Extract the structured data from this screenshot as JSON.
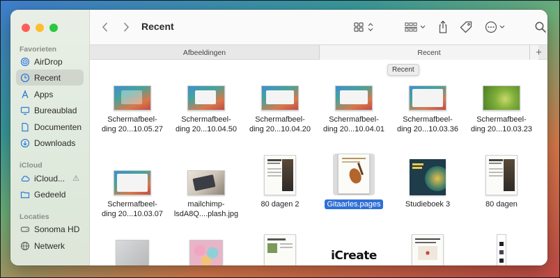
{
  "window": {
    "title": "Recent"
  },
  "sidebar": {
    "sections": [
      {
        "label": "Favorieten"
      },
      {
        "label": "iCloud"
      },
      {
        "label": "Locaties"
      }
    ],
    "items": [
      {
        "label": "AirDrop",
        "icon": "airdrop-icon"
      },
      {
        "label": "Recent",
        "icon": "clock-icon",
        "active": true
      },
      {
        "label": "Apps",
        "icon": "apps-icon"
      },
      {
        "label": "Bureaublad",
        "icon": "desktop-icon"
      },
      {
        "label": "Documenten",
        "icon": "document-icon"
      },
      {
        "label": "Downloads",
        "icon": "download-icon"
      },
      {
        "label": "iCloud...",
        "icon": "cloud-icon"
      },
      {
        "label": "Gedeeld",
        "icon": "shared-folder-icon"
      },
      {
        "label": "Sonoma HD",
        "icon": "disk-icon"
      },
      {
        "label": "Netwerk",
        "icon": "network-icon"
      }
    ]
  },
  "tabs": [
    {
      "label": "Afbeeldingen"
    },
    {
      "label": "Recent"
    }
  ],
  "tooltip": "Recent",
  "files": [
    {
      "line1": "Schermafbeel-",
      "line2": "ding 20...10.05.27",
      "kind": "screenshot"
    },
    {
      "line1": "Schermafbeel-",
      "line2": "ding 20...10.04.50",
      "kind": "screenshot"
    },
    {
      "line1": "Schermafbeel-",
      "line2": "ding 20...10.04.20",
      "kind": "screenshot"
    },
    {
      "line1": "Schermafbeel-",
      "line2": "ding 20...10.04.01",
      "kind": "screenshot"
    },
    {
      "line1": "Schermafbeel-",
      "line2": "ding 20...10.03.36",
      "kind": "screenshot"
    },
    {
      "line1": "Schermafbeel-",
      "line2": "ding 20...10.03.23",
      "kind": "screenshot-green"
    },
    {
      "line1": "Schermafbeel-",
      "line2": "ding 20...10.03.07",
      "kind": "screenshot"
    },
    {
      "line1": "mailchimp-",
      "line2": "lsdA8Q....plash.jpg",
      "kind": "photo"
    },
    {
      "line1": "80 dagen 2",
      "line2": "",
      "kind": "document"
    },
    {
      "line1": "Gitaarles.pages",
      "line2": "",
      "kind": "pages",
      "selected": true
    },
    {
      "line1": "Studieboek 3",
      "line2": "",
      "kind": "book"
    },
    {
      "line1": "80 dagen",
      "line2": "",
      "kind": "document"
    }
  ],
  "partial_row": {
    "icreate_text": "iCreate"
  },
  "colors": {
    "selection": "#2f6fd6",
    "sidebar_accent": "#2e7bd6"
  }
}
